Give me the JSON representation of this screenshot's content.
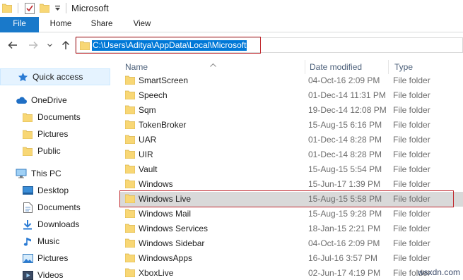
{
  "window": {
    "title": "Microsoft"
  },
  "ribbon": {
    "tabs": [
      "File",
      "Home",
      "Share",
      "View"
    ]
  },
  "address_bar": {
    "path": "C:\\Users\\Aditya\\AppData\\Local\\Microsoft"
  },
  "nav_pane": {
    "items": [
      {
        "label": "Quick access",
        "icon": "star-icon"
      },
      {
        "label": "OneDrive",
        "icon": "cloud-icon"
      },
      {
        "label": "Documents",
        "icon": "folder-icon"
      },
      {
        "label": "Pictures",
        "icon": "folder-icon"
      },
      {
        "label": "Public",
        "icon": "folder-icon"
      },
      {
        "label": "This PC",
        "icon": "computer-icon"
      },
      {
        "label": "Desktop",
        "icon": "desktop-icon"
      },
      {
        "label": "Documents",
        "icon": "documents-icon"
      },
      {
        "label": "Downloads",
        "icon": "downloads-icon"
      },
      {
        "label": "Music",
        "icon": "music-icon"
      },
      {
        "label": "Pictures",
        "icon": "pictures-icon"
      },
      {
        "label": "Videos",
        "icon": "videos-icon"
      }
    ]
  },
  "file_list": {
    "columns": [
      "Name",
      "Date modified",
      "Type"
    ],
    "rows": [
      {
        "name": "SmartScreen",
        "date": "04-Oct-16 2:09 PM",
        "type": "File folder"
      },
      {
        "name": "Speech",
        "date": "01-Dec-14 11:31 PM",
        "type": "File folder"
      },
      {
        "name": "Sqm",
        "date": "19-Dec-14 12:08 PM",
        "type": "File folder"
      },
      {
        "name": "TokenBroker",
        "date": "15-Aug-15 6:16 PM",
        "type": "File folder"
      },
      {
        "name": "UAR",
        "date": "01-Dec-14 8:28 PM",
        "type": "File folder"
      },
      {
        "name": "UIR",
        "date": "01-Dec-14 8:28 PM",
        "type": "File folder"
      },
      {
        "name": "Vault",
        "date": "15-Aug-15 5:54 PM",
        "type": "File folder"
      },
      {
        "name": "Windows",
        "date": "15-Jun-17 1:39 PM",
        "type": "File folder"
      },
      {
        "name": "Windows Live",
        "date": "15-Aug-15 5:58 PM",
        "type": "File folder"
      },
      {
        "name": "Windows Mail",
        "date": "15-Aug-15 9:28 PM",
        "type": "File folder"
      },
      {
        "name": "Windows Services",
        "date": "18-Jan-15 2:21 PM",
        "type": "File folder"
      },
      {
        "name": "Windows Sidebar",
        "date": "04-Oct-16 2:09 PM",
        "type": "File folder"
      },
      {
        "name": "WindowsApps",
        "date": "16-Jul-16 3:57 PM",
        "type": "File folder"
      },
      {
        "name": "XboxLive",
        "date": "02-Jun-17 4:19 PM",
        "type": "File folder"
      }
    ],
    "selected_index": 8
  },
  "watermark": "wsxdn.com",
  "colors": {
    "file_tab": "#1979ca",
    "selection": "#0078d7",
    "highlight_box": "#c0272d",
    "folder": "#f8d775"
  }
}
